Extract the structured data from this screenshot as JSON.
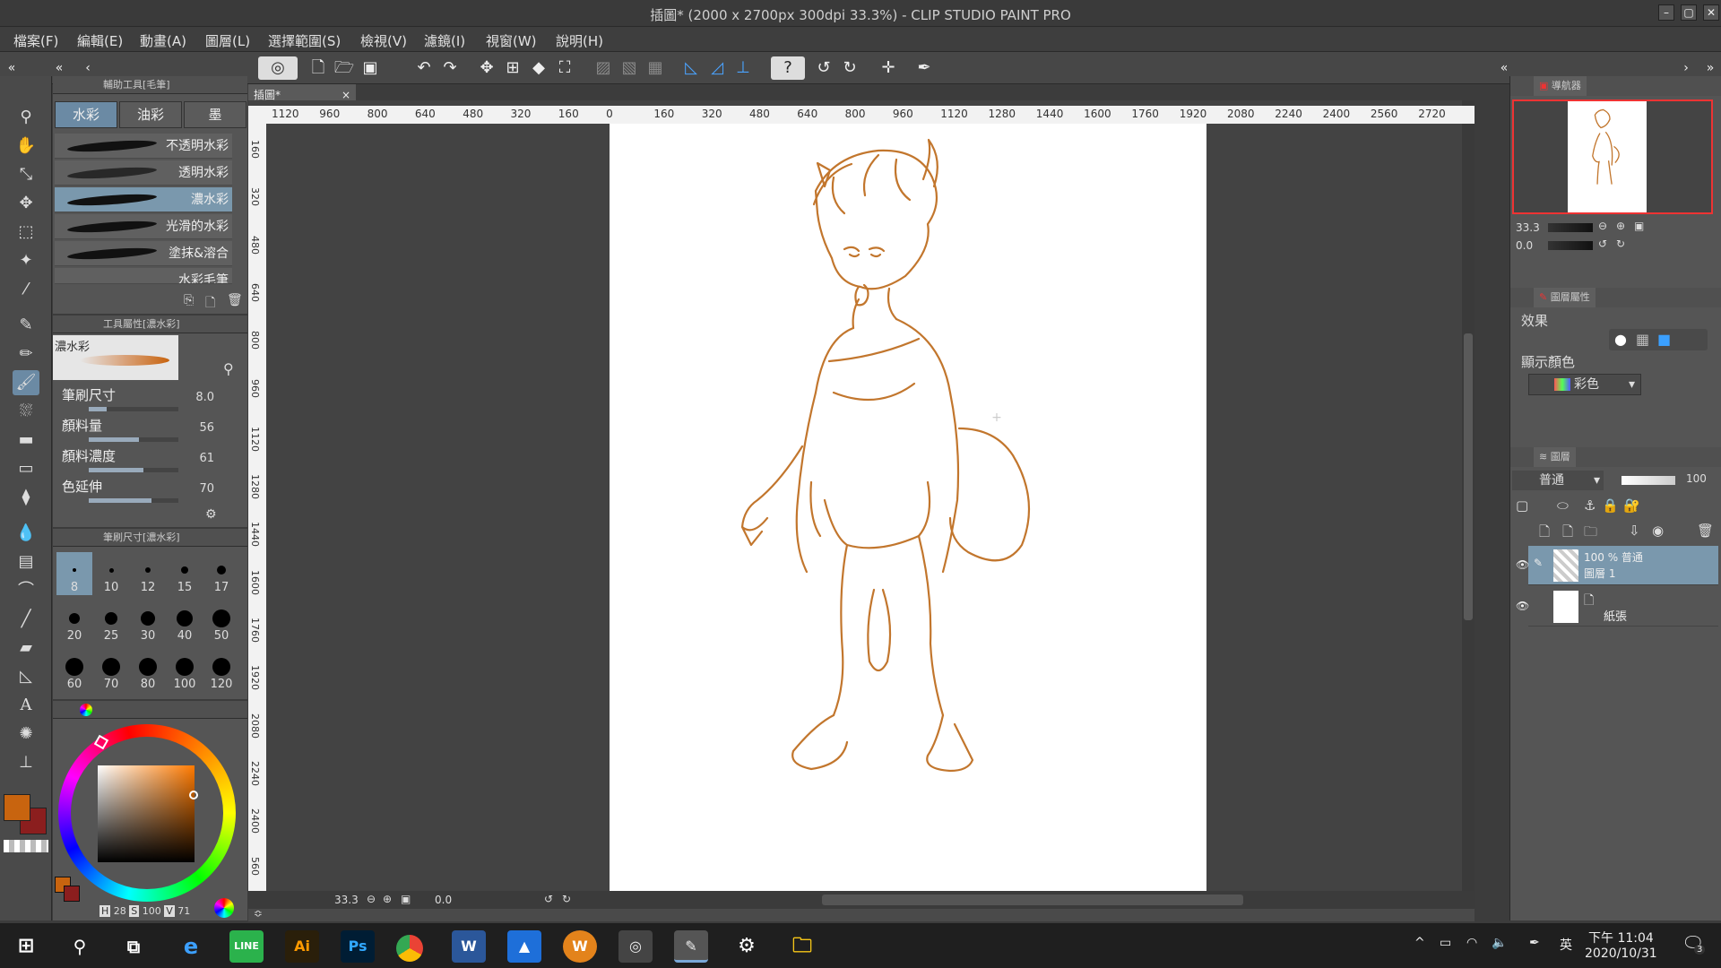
{
  "window": {
    "title": "插圖* (2000 x 2700px 300dpi 33.3%) - CLIP STUDIO PAINT PRO"
  },
  "menu": [
    "檔案(F)",
    "編輯(E)",
    "動畫(A)",
    "圖層(L)",
    "選擇範圍(S)",
    "檢視(V)",
    "濾鏡(I)",
    "視窗(W)",
    "說明(H)"
  ],
  "subtool_panel": {
    "title": "輔助工具[毛筆]",
    "tabs": [
      "水彩",
      "油彩",
      "墨"
    ],
    "brushes": [
      "不透明水彩",
      "透明水彩",
      "濃水彩",
      "光滑的水彩",
      "塗抹&溶合",
      "水彩毛筆"
    ]
  },
  "tool_property": {
    "title": "工具屬性[濃水彩]",
    "preview_label": "濃水彩",
    "props": [
      {
        "label": "筆刷尺寸",
        "value": "8.0",
        "fill": 0.2
      },
      {
        "label": "顏料量",
        "value": "56",
        "fill": 0.56
      },
      {
        "label": "顏料濃度",
        "value": "61",
        "fill": 0.61
      },
      {
        "label": "色延伸",
        "value": "70",
        "fill": 0.7
      }
    ]
  },
  "brush_size": {
    "title": "筆刷尺寸[濃水彩]",
    "sizes": [
      "8",
      "10",
      "12",
      "15",
      "17",
      "20",
      "25",
      "30",
      "40",
      "50",
      "60",
      "70",
      "80",
      "100",
      "120"
    ]
  },
  "color": {
    "main": "#c8640f",
    "sub": "#8b1e1e",
    "hsv_h": "28",
    "hsv_s": "100",
    "hsv_v": "71"
  },
  "canvas": {
    "tab": "插圖*",
    "ruler_h": [
      "1120",
      "960",
      "800",
      "640",
      "480",
      "320",
      "160",
      "0",
      "160",
      "320",
      "480",
      "640",
      "800",
      "960",
      "1120",
      "1280",
      "1440",
      "1600",
      "1760",
      "1920",
      "2080",
      "2240",
      "2400",
      "2560",
      "2720"
    ],
    "ruler_v": [
      "160",
      "320",
      "480",
      "640",
      "800",
      "960",
      "1120",
      "1280",
      "1440",
      "1600",
      "1760",
      "1920",
      "2080",
      "2240",
      "2400",
      "560"
    ],
    "zoom": "33.3",
    "angle": "0.0"
  },
  "navigator": {
    "tab": "導航器",
    "zoom": "33.3",
    "angle": "0.0"
  },
  "layer_property": {
    "tab": "圖層屬性",
    "effect_label": "效果",
    "display_color_label": "顯示顏色",
    "display_color_value": "彩色"
  },
  "layers": {
    "tab": "圖層",
    "blend_mode": "普通",
    "opacity": "100",
    "items": [
      {
        "line1": "100 % 普通",
        "line2": "圖層 1"
      },
      {
        "line1": "",
        "line2": "紙張"
      }
    ]
  },
  "taskbar": {
    "apps": [
      "LINE",
      "Ai",
      "Ps",
      "Chrome",
      "Word",
      "Photos",
      "Wacom",
      "CSP",
      "CSP-2",
      "Settings",
      "Explorer"
    ],
    "ime": "英",
    "time": "下午 11:04",
    "date": "2020/10/31",
    "notifications": "3"
  }
}
